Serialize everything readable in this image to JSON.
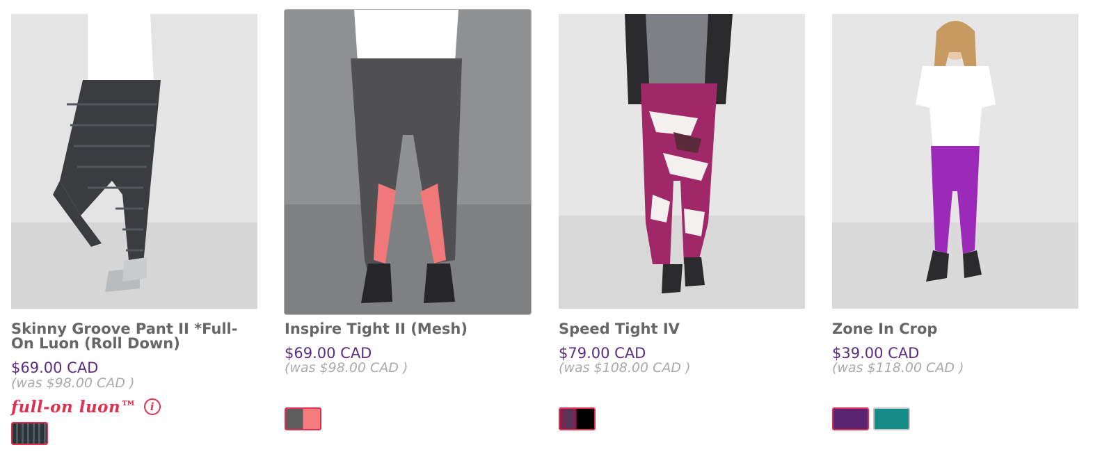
{
  "products": [
    {
      "name": "Skinny Groove Pant II *Full-On Luon (Roll Down)",
      "price": "$69.00 CAD",
      "was": "(was $98.00 CAD )",
      "fabric_label": "full-on luon™",
      "info_icon": "info-icon",
      "swatches": [
        {
          "name": "dark-stripe-swatch",
          "colors": [
            "#2d3338",
            "#4c5a66"
          ],
          "selected": true
        }
      ]
    },
    {
      "name": "Inspire Tight II (Mesh)",
      "price": "$69.00 CAD",
      "was": "(was $98.00 CAD )",
      "swatches": [
        {
          "name": "heathered-grey-coral-swatch",
          "colors": [
            "#5e5e5e",
            "#f47c7c"
          ],
          "selected": true
        }
      ]
    },
    {
      "name": "Speed Tight IV",
      "price": "$79.00 CAD",
      "was": "(was $108.00 CAD )",
      "swatches": [
        {
          "name": "print-black-swatch",
          "colors": [
            "#8c2050",
            "#000000"
          ],
          "selected": true
        }
      ]
    },
    {
      "name": "Zone In Crop",
      "price": "$39.00 CAD",
      "was": "(was $118.00 CAD )",
      "swatches": [
        {
          "name": "purple-swatch",
          "colors": [
            "#5a2471"
          ],
          "selected": true
        },
        {
          "name": "teal-swatch",
          "colors": [
            "#158c88"
          ],
          "selected": false
        }
      ]
    }
  ],
  "colors": {
    "price": "#5b2d82",
    "was": "#a9a9a9",
    "name": "#666666",
    "accent": "#e0304f"
  }
}
